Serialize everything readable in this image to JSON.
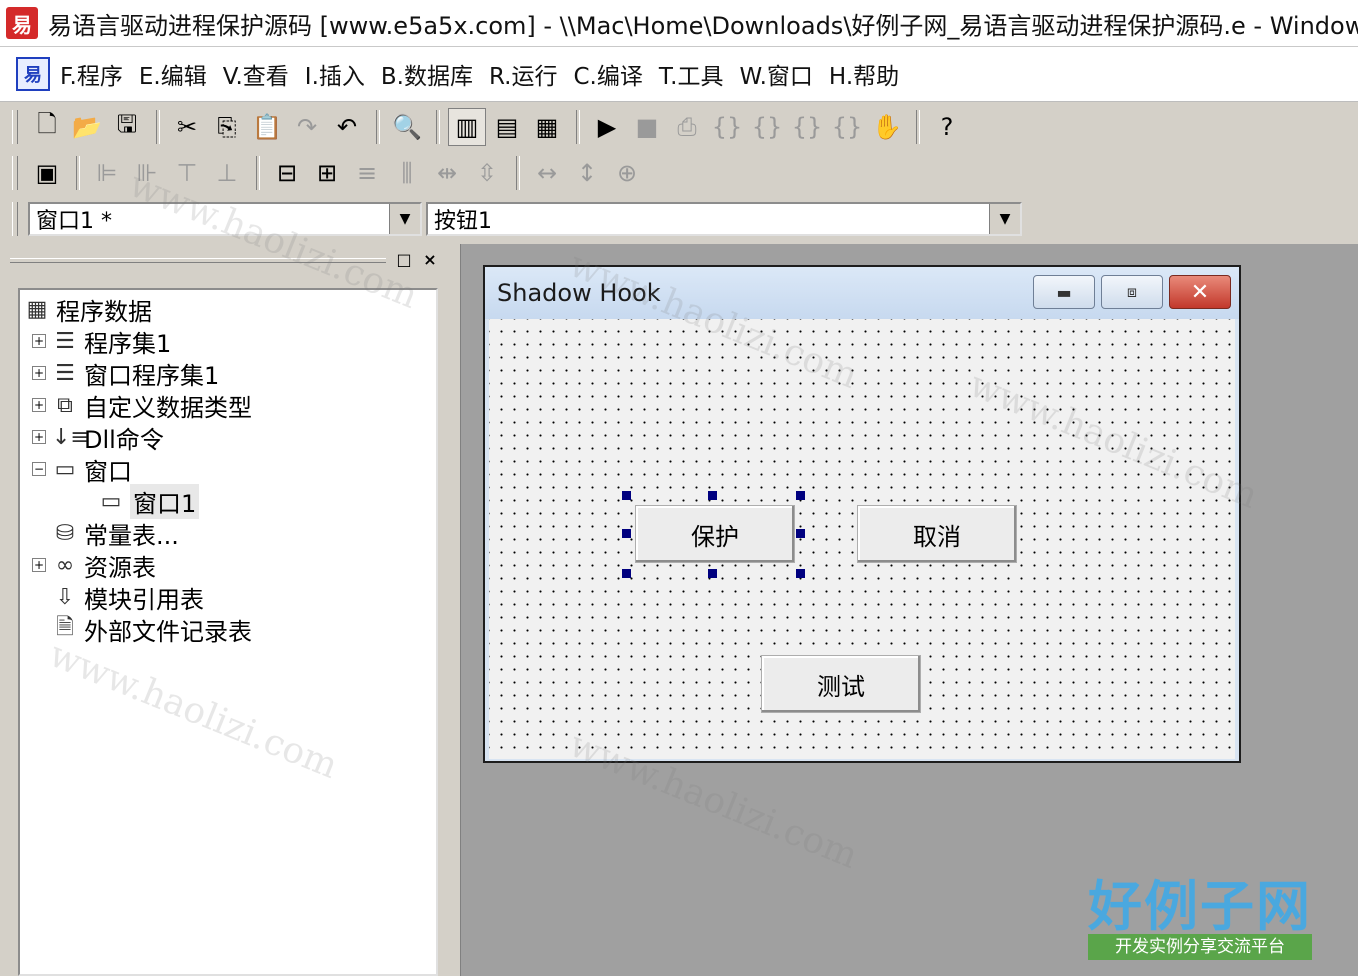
{
  "window": {
    "app_icon": "易",
    "title": "易语言驱动进程保护源码 [www.e5a5x.com] - \\\\Mac\\Home\\Downloads\\好例子网_易语言驱动进程保护源码.e - Windows"
  },
  "menu": {
    "logo_icon": "app-logo-icon",
    "items": [
      {
        "label": "F.程序"
      },
      {
        "label": "E.编辑"
      },
      {
        "label": "V.查看"
      },
      {
        "label": "I.插入"
      },
      {
        "label": "B.数据库"
      },
      {
        "label": "R.运行"
      },
      {
        "label": "C.编译"
      },
      {
        "label": "T.工具"
      },
      {
        "label": "W.窗口"
      },
      {
        "label": "H.帮助"
      }
    ]
  },
  "toolbar1": {
    "icons": [
      "new-file-icon",
      "open-folder-icon",
      "save-icon",
      "cut-icon",
      "copy-icon",
      "paste-icon",
      "redo-icon",
      "undo-icon",
      "find-icon",
      "layout-left-icon",
      "layout-top-icon",
      "layout-grid-icon",
      "run-icon",
      "stop-icon",
      "step-icon",
      "step-into-icon",
      "step-over-icon",
      "step-out-icon",
      "run-to-cursor-icon",
      "hand-icon",
      "help-search-icon"
    ]
  },
  "toolbar2": {
    "icons": [
      "calculator-icon",
      "align-left-icon",
      "align-right-icon",
      "align-top-icon",
      "align-bottom-icon",
      "center-horizontal-icon",
      "center-vertical-icon",
      "same-width-icon",
      "same-height-icon",
      "space-horizontal-icon",
      "space-vertical-icon",
      "stretch-width-icon",
      "stretch-height-icon",
      "center-form-icon"
    ]
  },
  "selectors": {
    "window_combo": "窗口1 *",
    "control_combo": "按钮1"
  },
  "left_panel": {
    "restore_glyph": "□",
    "close_glyph": "×",
    "tree": [
      {
        "label": "程序数据",
        "icon": "program-data-icon"
      },
      {
        "label": "程序集1",
        "icon": "assembly-icon",
        "expander": "+"
      },
      {
        "label": "窗口程序集1",
        "icon": "window-assembly-icon",
        "expander": "+"
      },
      {
        "label": "自定义数据类型",
        "icon": "custom-type-icon",
        "expander": "+"
      },
      {
        "label": "Dll命令",
        "icon": "dll-command-icon",
        "expander": "+"
      },
      {
        "label": "窗口",
        "icon": "window-icon",
        "expander": "−"
      },
      {
        "label": "窗口1",
        "icon": "window-icon"
      },
      {
        "label": "常量表...",
        "icon": "constant-table-icon"
      },
      {
        "label": "资源表",
        "icon": "resource-table-icon",
        "expander": "+"
      },
      {
        "label": "模块引用表",
        "icon": "module-ref-icon"
      },
      {
        "label": "外部文件记录表",
        "icon": "external-file-icon"
      }
    ]
  },
  "form": {
    "title": "Shadow Hook",
    "buttons": {
      "protect": "保护",
      "cancel": "取消",
      "test": "测试"
    }
  },
  "brand": {
    "name": "好例子网",
    "tagline": "开发实例分享交流平台"
  },
  "watermark": "www.haolizi.com"
}
